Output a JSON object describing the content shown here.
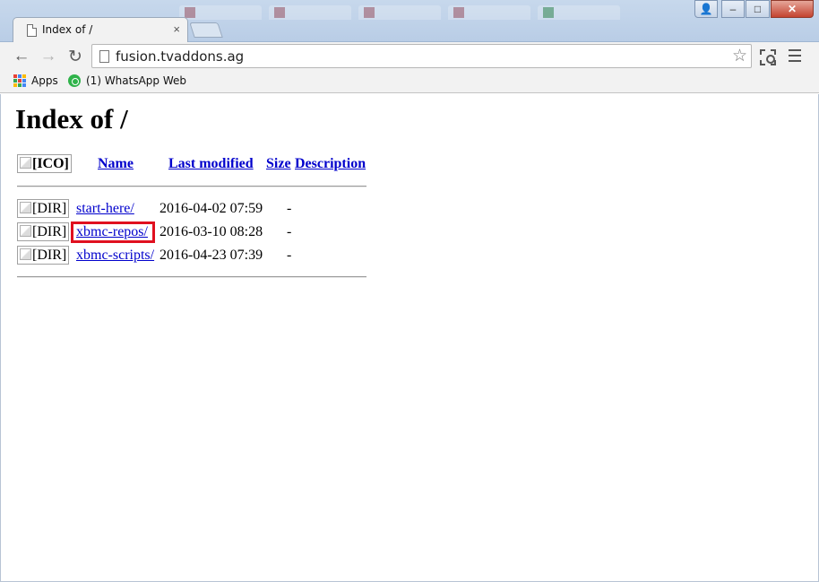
{
  "browser": {
    "tab_title": "Index of /",
    "tab_close": "×",
    "window_user": "👤",
    "window_min": "‒",
    "window_max": "□",
    "window_close": "✕",
    "address": "fusion.tvaddons.ag",
    "bookmarks": [
      {
        "label": "Apps",
        "icon": "apps-grid-icon"
      },
      {
        "label": "(1) WhatsApp Web",
        "icon": "whatsapp-icon"
      }
    ],
    "nav": {
      "back": "←",
      "forward": "→",
      "reload": "↻",
      "star": "☆"
    },
    "accent_close_color": "#c4432f"
  },
  "page": {
    "heading": "Index of /",
    "columns": {
      "icon_alt": "[ICO]",
      "name": "Name",
      "last_modified": "Last modified",
      "size": "Size",
      "description": "Description"
    },
    "entries": [
      {
        "icon_alt": "[DIR]",
        "name": "start-here/",
        "modified": "2016-04-02 07:59",
        "size": "-"
      },
      {
        "icon_alt": "[DIR]",
        "name": "xbmc-repos/",
        "modified": "2016-03-10 08:28",
        "size": "-",
        "highlighted": true
      },
      {
        "icon_alt": "[DIR]",
        "name": "xbmc-scripts/",
        "modified": "2016-04-23 07:39",
        "size": "-"
      }
    ],
    "highlight_color": "#e0101f",
    "link_color": "#0000cc"
  }
}
